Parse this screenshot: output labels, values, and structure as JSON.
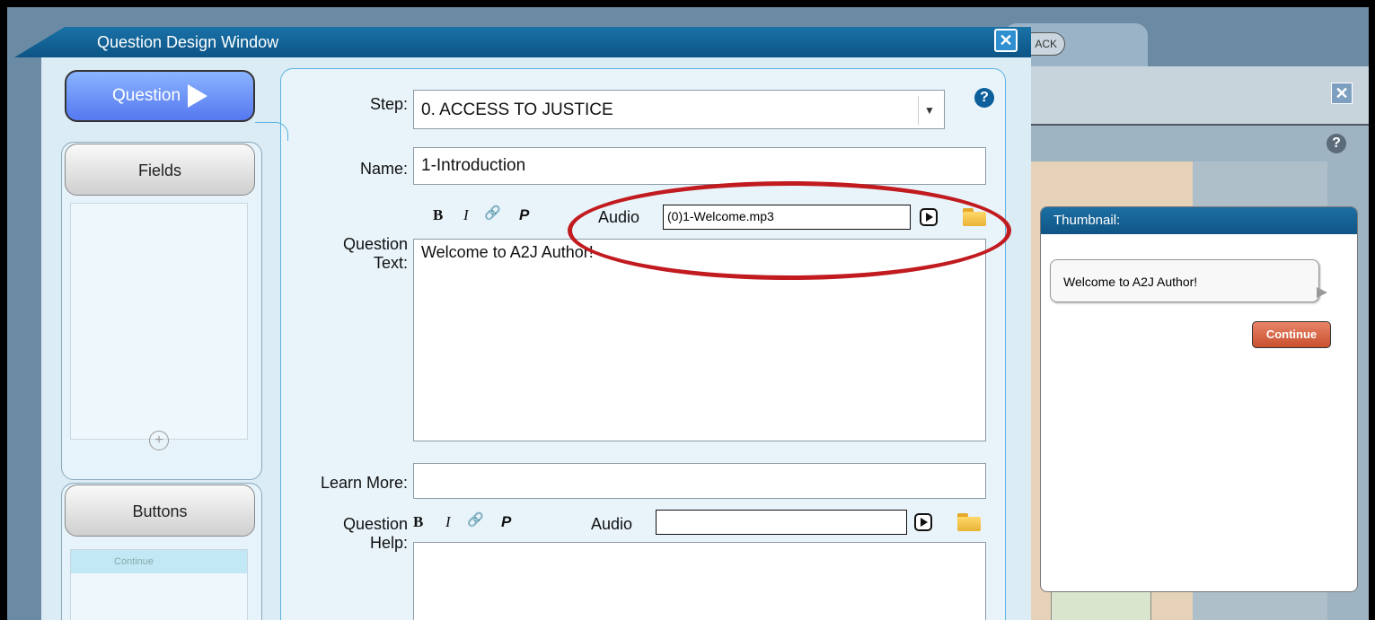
{
  "background": {
    "tab_pill": "ACK",
    "close": "✕",
    "help": "?"
  },
  "thumbnail": {
    "title": "Thumbnail:",
    "bubble_text": "Welcome to A2J Author!",
    "continue_label": "Continue"
  },
  "dialog": {
    "title": "Question Design Window",
    "close": "✕",
    "help": "?"
  },
  "left_tabs": {
    "question": "Question",
    "fields": "Fields",
    "add": "+",
    "buttons": "Buttons",
    "buttons_list": [
      "Continue"
    ]
  },
  "form": {
    "step_label": "Step:",
    "step_value": "0. ACCESS TO JUSTICE",
    "name_label": "Name:",
    "name_value": "1-Introduction",
    "format_bold": "B",
    "format_italic": "I",
    "format_link": "🔗",
    "format_p": "P",
    "audio_label": "Audio",
    "audio_value": "(0)1-Welcome.mp3",
    "question_text_label_1": "Question",
    "question_text_label_2": "Text:",
    "question_text_value": "Welcome to A2J Author!",
    "learn_more_label": "Learn More:",
    "learn_more_value": "",
    "help_label_1": "Question",
    "help_label_2": "Help:",
    "help_audio_label": "Audio",
    "help_audio_value": "",
    "help_text_value": ""
  },
  "colors": {
    "titlebar": "#0c5486",
    "highlight": "#c11b20",
    "continue_button": "#c9502f"
  }
}
